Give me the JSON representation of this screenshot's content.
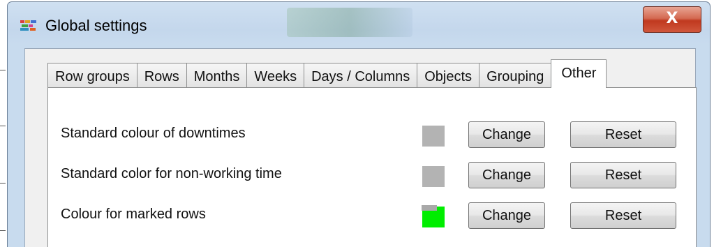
{
  "window": {
    "title": "Global settings",
    "close_label": "X"
  },
  "tabs": [
    {
      "label": "Row groups",
      "active": false
    },
    {
      "label": "Rows",
      "active": false
    },
    {
      "label": "Months",
      "active": false
    },
    {
      "label": "Weeks",
      "active": false
    },
    {
      "label": "Days / Columns",
      "active": false
    },
    {
      "label": "Objects",
      "active": false
    },
    {
      "label": "Grouping",
      "active": false
    },
    {
      "label": "Other",
      "active": true
    }
  ],
  "settings": [
    {
      "label": "Standard colour of downtimes",
      "color": "#b3b3b3",
      "change_label": "Change",
      "reset_label": "Reset"
    },
    {
      "label": "Standard color for non-working time",
      "color": "#b3b3b3",
      "change_label": "Change",
      "reset_label": "Reset"
    },
    {
      "label": "Colour for marked rows",
      "color": "#00ee00",
      "change_label": "Change",
      "reset_label": "Reset"
    }
  ],
  "icons": {
    "app": "app-icon",
    "close": "close-icon"
  }
}
